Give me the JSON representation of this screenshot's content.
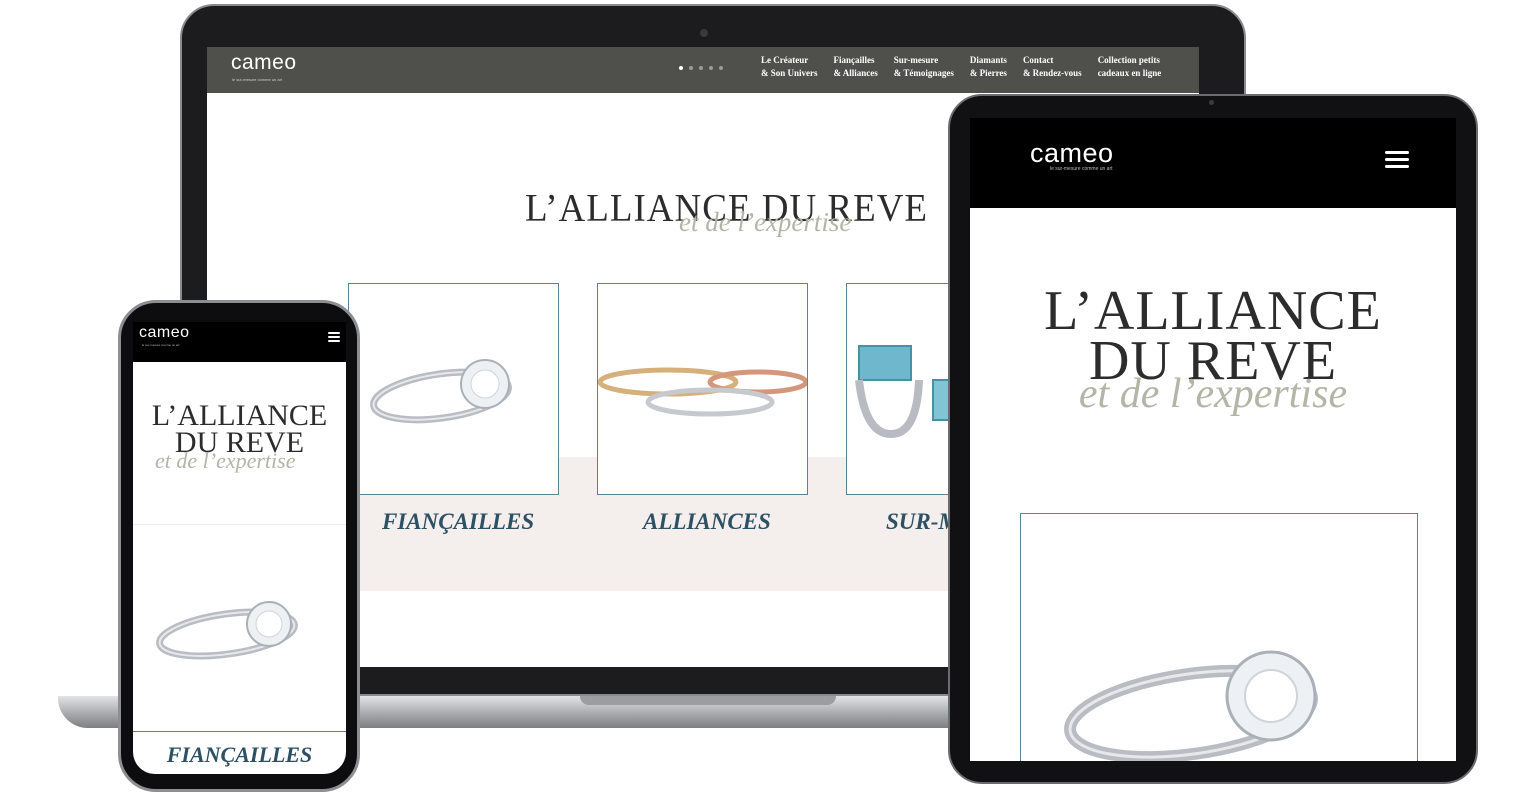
{
  "brand": {
    "logo": "cameo",
    "tagline": "le sur-mesure comme un art",
    "accent_color": "#2c5064",
    "sub_color": "#b3b5a6",
    "nav_color": "#4f4f4c"
  },
  "laptop": {
    "menu": [
      {
        "line1": "Le Créateur",
        "line2": "& Son Univers"
      },
      {
        "line1": "Fiançailles",
        "line2": "& Alliances"
      },
      {
        "line1": "Sur-mesure",
        "line2": "& Témoignages"
      },
      {
        "line1": "Diamants",
        "line2": "& Pierres"
      },
      {
        "line1": "Contact",
        "line2": "& Rendez-vous"
      },
      {
        "line1": "Collection petits",
        "line2": "cadeaux en ligne"
      }
    ],
    "hero_title": "L’ALLIANCE DU REVE",
    "hero_subtitle": "et de l’expertise",
    "categories": [
      "FIANÇAILLES",
      "ALLIANCES",
      "SUR-M"
    ]
  },
  "tablet": {
    "title_line1": "L’ALLIANCE",
    "title_line2": "DU REVE",
    "subtitle": "et de l’expertise"
  },
  "phone": {
    "title_line1": "L’ALLIANCE",
    "title_line2": "DU REVE",
    "subtitle": "et de l’expertise",
    "category": "FIANÇAILLES"
  },
  "icons": [
    "menu-icon",
    "slider-dots"
  ]
}
